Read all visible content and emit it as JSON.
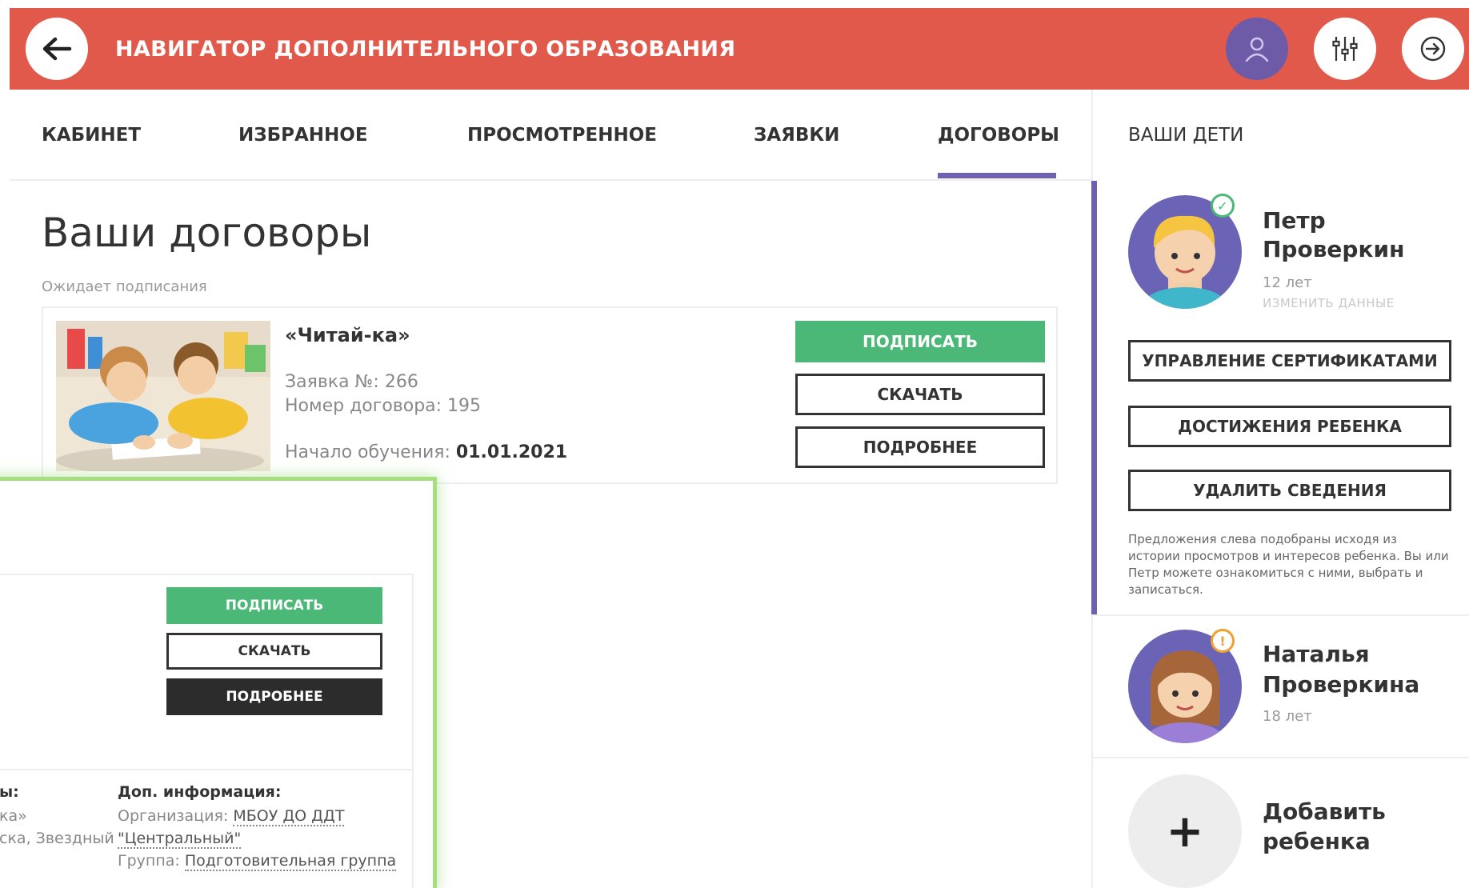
{
  "header": {
    "title": "НАВИГАТОР ДОПОЛНИТЕЛЬНОГО ОБРАЗОВАНИЯ",
    "icons": [
      "back-arrow-icon",
      "user-icon",
      "sliders-icon",
      "logout-icon"
    ]
  },
  "tabs": [
    {
      "label": "КАБИНЕТ"
    },
    {
      "label": "ИЗБРАННОЕ"
    },
    {
      "label": "ПРОСМОТРЕННОЕ"
    },
    {
      "label": "ЗАЯВКИ"
    },
    {
      "label": "ДОГОВОРЫ",
      "active": true
    }
  ],
  "main": {
    "title": "Ваши договоры",
    "status": "Ожидает подписания",
    "contract": {
      "name": "«Читай-ка»",
      "request_label": "Заявка №: 266",
      "contract_label": "Номер договора: 195",
      "start_label": "Начало обучения: ",
      "start_date": "01.01.2021",
      "buttons": {
        "sign": "ПОДПИСАТЬ",
        "download": "СКАЧАТЬ",
        "details": "ПОДРОБНЕЕ"
      }
    }
  },
  "overlay": {
    "buttons": {
      "sign": "ПОДПИСАТЬ",
      "download": "СКАЧАТЬ",
      "details": "ПОДРОБНЕЕ"
    },
    "left_col": {
      "head": "ы:",
      "line1": "ка»",
      "line2": "ска, Звездный"
    },
    "right_col": {
      "head": "Доп. информация:",
      "org_label": "Организация: ",
      "org_value_1": "МБОУ ДО ДДТ",
      "org_value_2": "\"Центральный\"",
      "group_label": "Группа: ",
      "group_value": "Подготовительная группа"
    }
  },
  "sidebar": {
    "title": "ВАШИ ДЕТИ",
    "children": [
      {
        "first_name": "Петр",
        "last_name": "Проверкин",
        "age": "12 лет",
        "edit": "ИЗМЕНИТЬ ДАННЫЕ",
        "badge": "✓",
        "badge_color": "#4cb877"
      },
      {
        "first_name": "Наталья",
        "last_name": "Проверкина",
        "age": "18 лет",
        "badge": "!",
        "badge_color": "#f0a030"
      }
    ],
    "buttons": {
      "certificates": "УПРАВЛЕНИЕ СЕРТИФИКАТАМИ",
      "achievements": "ДОСТИЖЕНИЯ РЕБЕНКА",
      "delete": "УДАЛИТЬ СВЕДЕНИЯ"
    },
    "note": "Предложения слева подобраны исходя из истории просмотров и интересов ребенка. Вы или Петр можете ознакомиться с ними, выбрать и записаться.",
    "add_child": {
      "plus": "+",
      "line1": "Добавить",
      "line2": "ребенка"
    }
  },
  "colors": {
    "header_bg": "#e0594a",
    "accent": "#6f61ad",
    "green": "#4cb877",
    "dark": "#2c2c2c"
  }
}
